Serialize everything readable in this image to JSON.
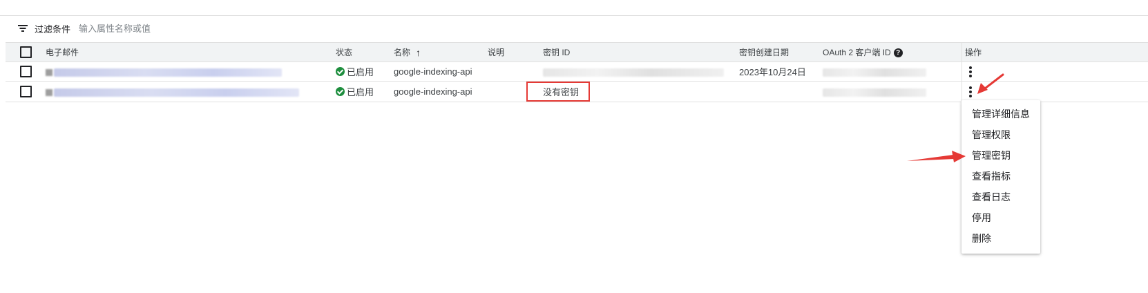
{
  "filter": {
    "label": "过滤条件",
    "placeholder": "输入属性名称或值"
  },
  "table": {
    "headers": {
      "email": "电子邮件",
      "status": "状态",
      "name": "名称",
      "description": "说明",
      "key_id": "密钥 ID",
      "key_created": "密钥创建日期",
      "oauth_client_id": "OAuth 2 客户端 ID",
      "actions": "操作"
    },
    "rows": [
      {
        "status": "已启用",
        "name": "google-indexing-api",
        "key_created": "2023年10月24日"
      },
      {
        "status": "已启用",
        "name": "google-indexing-api",
        "key_id_text": "没有密钥"
      }
    ]
  },
  "context_menu": {
    "items": [
      "管理详细信息",
      "管理权限",
      "管理密钥",
      "查看指标",
      "查看日志",
      "停用",
      "删除"
    ]
  },
  "colors": {
    "status_ok": "#1e8e3e",
    "annotation_red": "#e53935",
    "header_bg": "#f1f3f4"
  }
}
